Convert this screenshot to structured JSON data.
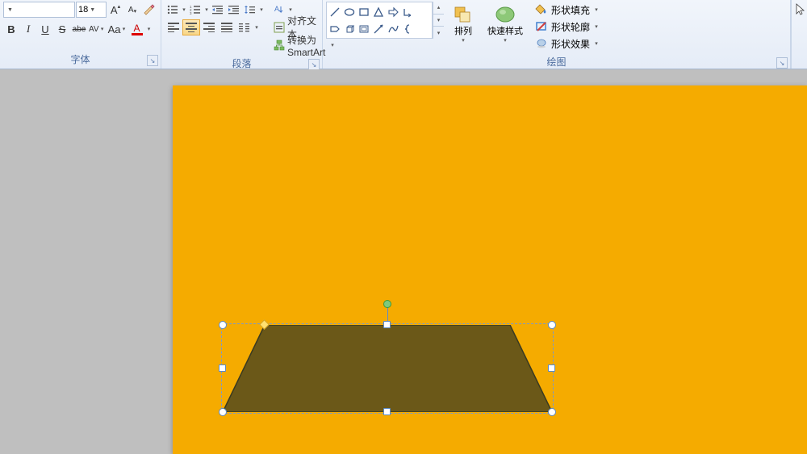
{
  "font_group": {
    "label": "字体",
    "size_value": "18",
    "bold": "B",
    "italic": "I",
    "strike": "S",
    "abc": "abe",
    "spacing": "AV",
    "case": "Aa",
    "clear": "A",
    "color": "A"
  },
  "para_group": {
    "label": "段落",
    "direction": "文字方向",
    "align_text": "对齐文本",
    "smartart": "转换为 SmartArt"
  },
  "draw_group": {
    "label": "绘图",
    "arrange": "排列",
    "quickstyles": "快速样式",
    "fill": "形状填充",
    "outline": "形状轮廓",
    "effects": "形状效果"
  }
}
